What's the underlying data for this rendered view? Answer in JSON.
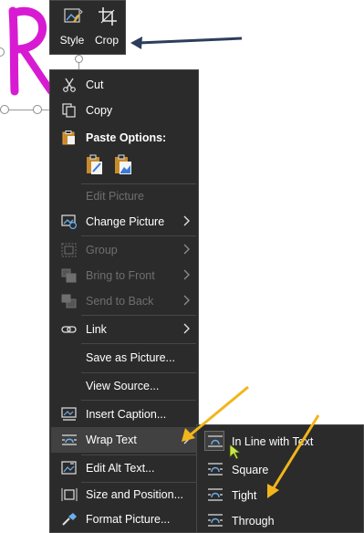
{
  "mini_toolbar": {
    "style_label": "Style",
    "crop_label": "Crop"
  },
  "context_menu": {
    "items": [
      {
        "name": "cut",
        "label": "Cut"
      },
      {
        "name": "copy",
        "label": "Copy"
      },
      {
        "name": "paste-options",
        "label": "Paste Options:"
      },
      {
        "name": "edit-picture",
        "label": "Edit Picture"
      },
      {
        "name": "change-picture",
        "label": "Change Picture"
      },
      {
        "name": "group",
        "label": "Group"
      },
      {
        "name": "bring-to-front",
        "label": "Bring to Front"
      },
      {
        "name": "send-to-back",
        "label": "Send to Back"
      },
      {
        "name": "link",
        "label": "Link"
      },
      {
        "name": "save-as-picture",
        "label": "Save as Picture..."
      },
      {
        "name": "view-source",
        "label": "View Source..."
      },
      {
        "name": "insert-caption",
        "label": "Insert Caption..."
      },
      {
        "name": "wrap-text",
        "label": "Wrap Text"
      },
      {
        "name": "edit-alt-text",
        "label": "Edit Alt Text..."
      },
      {
        "name": "size-and-position",
        "label": "Size and Position..."
      },
      {
        "name": "format-picture",
        "label": "Format Picture..."
      }
    ]
  },
  "wrap_submenu": {
    "items": [
      {
        "label": "In Line with Text"
      },
      {
        "label": "Square"
      },
      {
        "label": "Tight"
      },
      {
        "label": "Through"
      }
    ]
  },
  "colors": {
    "menu_bg": "#2b2b2b",
    "hover_bg": "#414141",
    "disabled_text": "#6f6f6f",
    "picture_magenta": "#d81bd2",
    "annotation_arrow_yellow": "#f2b51c",
    "annotation_arrow_navy": "#2c3e5c"
  }
}
